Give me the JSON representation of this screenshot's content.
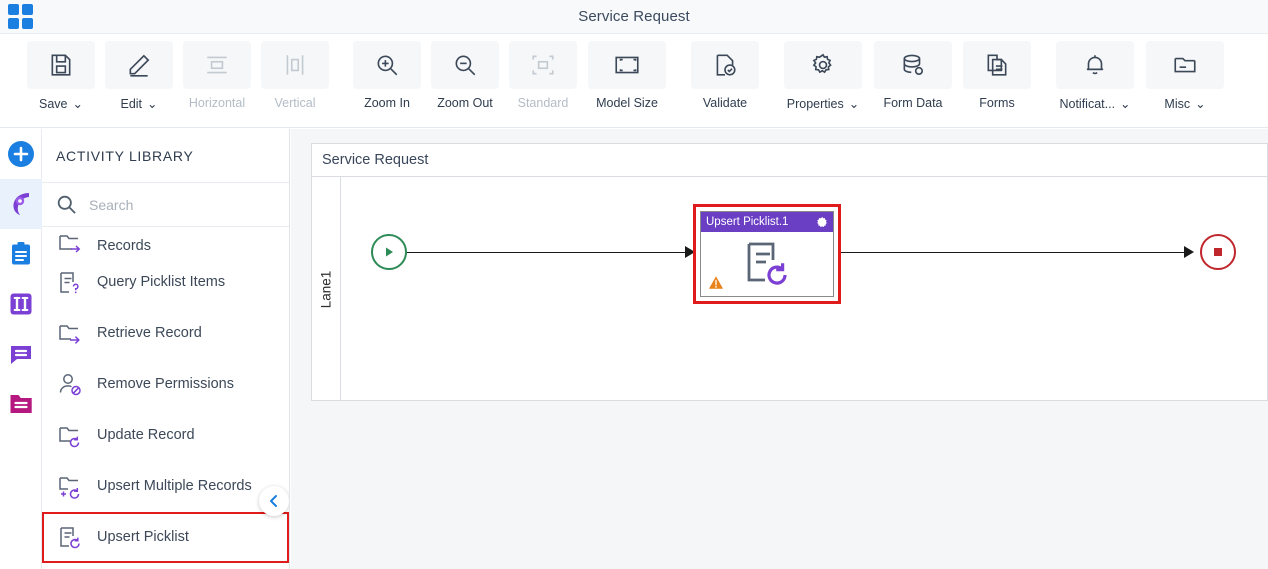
{
  "window": {
    "title": "Service Request",
    "apps_icon": "apps-grid-icon"
  },
  "toolbar": {
    "items": [
      {
        "label": "Save",
        "icon": "save-icon",
        "caret": true,
        "disabled": false
      },
      {
        "label": "Edit",
        "icon": "edit-pencil-icon",
        "caret": true,
        "disabled": false
      },
      {
        "label": "Horizontal",
        "icon": "align-horizontal-icon",
        "caret": false,
        "disabled": true
      },
      {
        "label": "Vertical",
        "icon": "align-vertical-icon",
        "caret": false,
        "disabled": true
      },
      {
        "label": "Zoom In",
        "icon": "zoom-in-icon",
        "caret": false,
        "disabled": false
      },
      {
        "label": "Zoom Out",
        "icon": "zoom-out-icon",
        "caret": false,
        "disabled": false
      },
      {
        "label": "Standard",
        "icon": "standard-size-icon",
        "caret": false,
        "disabled": true
      },
      {
        "label": "Model Size",
        "icon": "model-size-icon",
        "caret": false,
        "disabled": false
      },
      {
        "label": "Validate",
        "icon": "validate-icon",
        "caret": false,
        "disabled": false
      },
      {
        "label": "Properties",
        "icon": "gear-icon",
        "caret": true,
        "disabled": false
      },
      {
        "label": "Form Data",
        "icon": "database-icon",
        "caret": false,
        "disabled": false
      },
      {
        "label": "Forms",
        "icon": "forms-icon",
        "caret": false,
        "disabled": false
      },
      {
        "label": "Notificat...",
        "icon": "bell-icon",
        "caret": true,
        "disabled": false
      },
      {
        "label": "Misc",
        "icon": "folder-misc-icon",
        "caret": true,
        "disabled": false
      }
    ],
    "caret_glyph": "⌄"
  },
  "rail": {
    "items": [
      {
        "name": "add-button",
        "icon": "plus-circle-icon",
        "color": "#1a7fe0",
        "active": false
      },
      {
        "name": "process-designer",
        "icon": "process-swirl-icon",
        "color": "#7b3fd4",
        "active": true
      },
      {
        "name": "tasks",
        "icon": "clipboard-icon",
        "color": "#1a7fe0",
        "active": false
      },
      {
        "name": "forms",
        "icon": "columns-icon",
        "color": "#7b3fd4",
        "active": false
      },
      {
        "name": "messages",
        "icon": "chat-icon",
        "color": "#7b3fd4",
        "active": false
      },
      {
        "name": "documents",
        "icon": "folder-icon",
        "color": "#b5187f",
        "active": false
      }
    ]
  },
  "library": {
    "title": "ACTIVITY LIBRARY",
    "search": {
      "placeholder": "Search",
      "value": "",
      "icon": "search-icon"
    },
    "items": [
      {
        "label": "Records",
        "icon": "retrieve-records-icon",
        "clipped": true,
        "highlighted": false
      },
      {
        "label": "Query Picklist Items",
        "icon": "query-picklist-icon",
        "clipped": false,
        "highlighted": false
      },
      {
        "label": "Retrieve Record",
        "icon": "retrieve-record-icon",
        "clipped": false,
        "highlighted": false
      },
      {
        "label": "Remove Permissions",
        "icon": "remove-permissions-icon",
        "clipped": false,
        "highlighted": false
      },
      {
        "label": "Update Record",
        "icon": "update-record-icon",
        "clipped": false,
        "highlighted": false
      },
      {
        "label": "Upsert Multiple Records",
        "icon": "upsert-multiple-records-icon",
        "clipped": false,
        "highlighted": false
      },
      {
        "label": "Upsert Picklist",
        "icon": "upsert-picklist-icon",
        "clipped": false,
        "highlighted": true
      }
    ],
    "collapse_icon": "chevron-left-icon"
  },
  "canvas": {
    "pool_title": "Service Request",
    "lane_label": "Lane1",
    "start_node": {
      "name": "start-event",
      "icon": "play-icon",
      "color": "#2e8b57"
    },
    "end_node": {
      "name": "end-event",
      "icon": "stop-square-icon",
      "color": "#c0272d"
    },
    "task": {
      "title": "Upsert Picklist.1",
      "header_color": "#6b3fc4",
      "selection_color": "#e01b1b",
      "gear_icon": "gear-icon",
      "body_icon": "upsert-picklist-icon",
      "warning_icon": "warning-triangle-icon",
      "warning_color": "#e8821a"
    }
  }
}
